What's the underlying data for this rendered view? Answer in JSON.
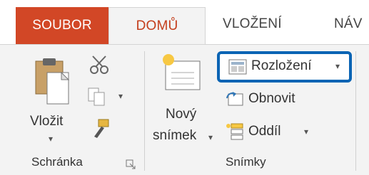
{
  "tabs": {
    "soubor": "SOUBOR",
    "domu": "DOMŮ",
    "vlozeni": "VLOŽENÍ",
    "nav": "NÁV"
  },
  "clipboard_group": {
    "paste_label": "Vložit",
    "group_label": "Schránka"
  },
  "slides_group": {
    "new_slide_line1": "Nový",
    "new_slide_line2": "snímek",
    "layout_label": "Rozložení",
    "reset_label": "Obnovit",
    "section_label": "Oddíl",
    "group_label": "Snímky"
  },
  "colors": {
    "file_tab": "#d24726",
    "active_tab_text": "#c43e1c",
    "highlight_border": "#0a64b4"
  }
}
